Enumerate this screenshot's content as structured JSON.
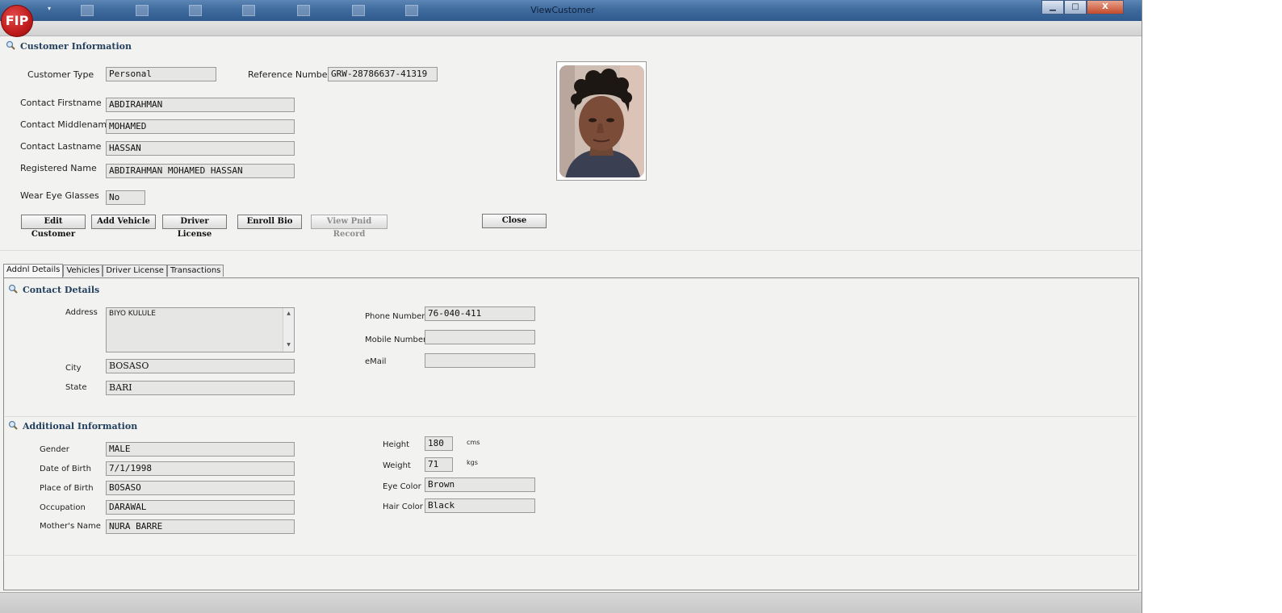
{
  "window": {
    "title": "ViewCustomer",
    "logo_text": "FIP"
  },
  "window_controls": {
    "minimize": "▁",
    "maximize": "□",
    "close": "X"
  },
  "customer_info": {
    "section_title": "Customer Information",
    "customer_type_label": "Customer Type",
    "customer_type": "Personal",
    "reference_number_label": "Reference Number",
    "reference_number": "GRW-28786637-41319",
    "firstname_label": "Contact Firstname",
    "firstname": "ABDIRAHMAN",
    "middlename_label": "Contact Middlename",
    "middlename": "MOHAMED",
    "lastname_label": "Contact Lastname",
    "lastname": "HASSAN",
    "registered_name_label": "Registered Name",
    "registered_name": "ABDIRAHMAN MOHAMED HASSAN",
    "eye_glasses_label": "Wear Eye Glasses",
    "eye_glasses": "No"
  },
  "buttons": {
    "edit_customer": "Edit Customer",
    "add_vehicle": "Add Vehicle",
    "driver_license": "Driver License",
    "enroll_bio": "Enroll Bio",
    "view_pnid_record": "View Pnid Record",
    "close": "Close"
  },
  "tabs": [
    "Addnl Details",
    "Vehicles",
    "Driver License",
    "Transactions"
  ],
  "contact_details": {
    "section_title": "Contact Details",
    "address_label": "Address",
    "address": "BIYO KULULE",
    "city_label": "City",
    "city": "BOSASO",
    "state_label": "State",
    "state": "BARI",
    "phone_label": "Phone Number",
    "phone": "76-040-411",
    "mobile_label": "Mobile Number",
    "mobile": "",
    "email_label": "eMail",
    "email": ""
  },
  "additional_info": {
    "section_title": "Additional Information",
    "gender_label": "Gender",
    "gender": "MALE",
    "dob_label": "Date of Birth",
    "dob": "7/1/1998",
    "pob_label": "Place of Birth",
    "pob": "BOSASO",
    "occupation_label": "Occupation",
    "occupation": "DARAWAL",
    "mother_label": "Mother's Name",
    "mother": "NURA BARRE",
    "height_label": "Height",
    "height": "180",
    "height_unit": "cms",
    "weight_label": "Weight",
    "weight": "71",
    "weight_unit": "kgs",
    "eye_color_label": "Eye Color",
    "eye_color": "Brown",
    "hair_color_label": "Hair Color",
    "hair_color": "Black"
  },
  "icons": {
    "section": "magnifier-icon",
    "scroll_up": "▲",
    "scroll_down": "▼",
    "dropdown": "▾"
  },
  "colors": {
    "titlebar": "#3f6b9e",
    "logo": "#c01c1c",
    "section_title": "#23405f"
  }
}
